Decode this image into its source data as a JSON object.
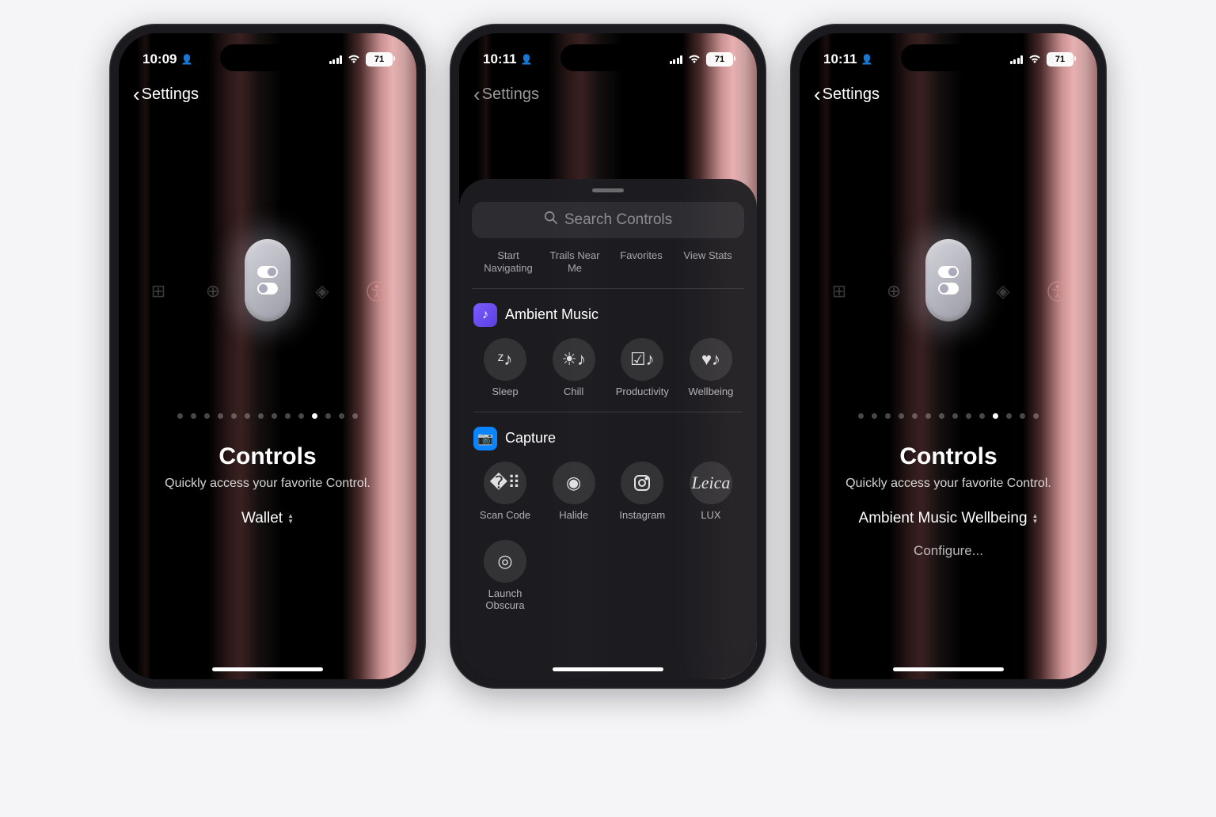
{
  "phones": [
    {
      "time": "10:09",
      "battery": "71",
      "back_label": "Settings",
      "title": "Controls",
      "subtitle": "Quickly access your favorite Control.",
      "selected_control": "Wallet",
      "pager_active": 10,
      "pager_count": 14
    },
    {
      "time": "10:11",
      "battery": "71",
      "back_label": "Settings",
      "search_placeholder": "Search Controls",
      "quick": [
        "Start Navigating",
        "Trails Near Me",
        "Favorites",
        "View Stats"
      ],
      "section_ambient": {
        "title": "Ambient Music",
        "items": [
          "Sleep",
          "Chill",
          "Productivity",
          "Wellbeing"
        ]
      },
      "section_capture": {
        "title": "Capture",
        "items": [
          "Scan Code",
          "Halide",
          "Instagram",
          "LUX",
          "Launch Obscura"
        ]
      }
    },
    {
      "time": "10:11",
      "battery": "71",
      "back_label": "Settings",
      "title": "Controls",
      "subtitle": "Quickly access your favorite Control.",
      "selected_control": "Ambient Music Wellbeing",
      "configure": "Configure...",
      "pager_active": 10,
      "pager_count": 14
    }
  ]
}
